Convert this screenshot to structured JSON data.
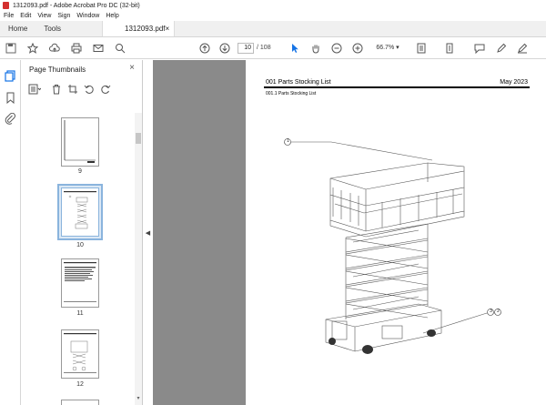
{
  "window": {
    "title": "1312093.pdf - Adobe Acrobat Pro DC (32-bit)"
  },
  "menu": {
    "items": [
      "File",
      "Edit",
      "View",
      "Sign",
      "Window",
      "Help"
    ]
  },
  "tabs": {
    "home": "Home",
    "tools": "Tools",
    "document": "1312093.pdf",
    "close": "×"
  },
  "toolbar": {
    "current_page": "10",
    "page_separator": "/",
    "total_pages": "108",
    "zoom": "66.7%"
  },
  "panel": {
    "title": "Page Thumbnails",
    "close": "×",
    "thumbnails": [
      {
        "label": "9"
      },
      {
        "label": "10",
        "selected": true
      },
      {
        "label": "11"
      },
      {
        "label": "12"
      }
    ]
  },
  "document": {
    "header_left": "001 Parts Stocking List",
    "header_right": "May 2023",
    "subheader": "001.1 Parts Stocking List",
    "callouts": [
      "1",
      "3",
      "2"
    ]
  },
  "colors": {
    "accent": "#1473e6",
    "viewer_bg": "#8a8a8a",
    "thumb_selected": "#dbe8f5"
  }
}
